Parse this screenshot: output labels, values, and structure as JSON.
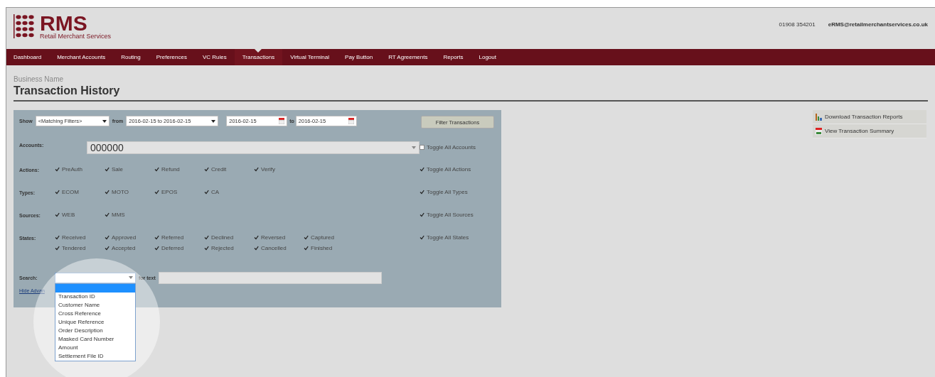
{
  "header": {
    "logo": {
      "name": "RMS",
      "tagline": "Retail Merchant Services"
    },
    "phone": "01908 354201",
    "email": "eRMS@retailmerchantservices.co.uk"
  },
  "nav": [
    {
      "label": "Dashboard",
      "selected": false
    },
    {
      "label": "Merchant Accounts",
      "selected": false
    },
    {
      "label": "Routing",
      "selected": false
    },
    {
      "label": "Preferences",
      "selected": false
    },
    {
      "label": "VC Rules",
      "selected": false
    },
    {
      "label": "Transactions",
      "selected": true
    },
    {
      "label": "Virtual Terminal",
      "selected": false
    },
    {
      "label": "Pay Button",
      "selected": false
    },
    {
      "label": "RT Agreements",
      "selected": false
    },
    {
      "label": "Reports",
      "selected": false
    },
    {
      "label": "Logout",
      "selected": false
    }
  ],
  "page": {
    "business_name": "Business Name",
    "title": "Transaction History"
  },
  "filters": {
    "show_label": "Show",
    "show_value": "<Matching Filters>",
    "from_label": "from",
    "range_value": "2016-02-15 to 2016-02-15",
    "date_from": "2016-02-15",
    "to_label": "to",
    "date_to": "2016-02-15",
    "filter_button": "Filter Transactions",
    "accounts": {
      "label": "Accounts:",
      "value": "000000",
      "toggle": {
        "label": "Toggle All Accounts",
        "checked": false
      }
    },
    "groups": [
      {
        "label": "Actions:",
        "rows": [
          [
            {
              "label": "PreAuth",
              "checked": true
            },
            {
              "label": "Sale",
              "checked": true
            },
            {
              "label": "Refund",
              "checked": true
            },
            {
              "label": "Credit",
              "checked": true
            },
            {
              "label": "Verify",
              "checked": true
            }
          ]
        ],
        "toggle": {
          "label": "Toggle All Actions",
          "checked": true
        }
      },
      {
        "label": "Types:",
        "rows": [
          [
            {
              "label": "ECOM",
              "checked": true
            },
            {
              "label": "MOTO",
              "checked": true
            },
            {
              "label": "EPOS",
              "checked": true
            },
            {
              "label": "CA",
              "checked": true
            }
          ]
        ],
        "toggle": {
          "label": "Toggle All Types",
          "checked": true
        }
      },
      {
        "label": "Sources:",
        "rows": [
          [
            {
              "label": "WEB",
              "checked": true
            },
            {
              "label": "MMS",
              "checked": true
            }
          ]
        ],
        "toggle": {
          "label": "Toggle All Sources",
          "checked": true
        }
      },
      {
        "label": "States:",
        "rows": [
          [
            {
              "label": "Received",
              "checked": true
            },
            {
              "label": "Approved",
              "checked": true
            },
            {
              "label": "Referred",
              "checked": true
            },
            {
              "label": "Declined",
              "checked": true
            },
            {
              "label": "Reversed",
              "checked": true
            },
            {
              "label": "Captured",
              "checked": true
            }
          ],
          [
            {
              "label": "Tendered",
              "checked": true
            },
            {
              "label": "Accepted",
              "checked": true
            },
            {
              "label": "Deferred",
              "checked": true
            },
            {
              "label": "Rejected",
              "checked": true
            },
            {
              "label": "Cancelled",
              "checked": true
            },
            {
              "label": "Finished",
              "checked": true
            }
          ]
        ],
        "toggle": {
          "label": "Toggle All States",
          "checked": true
        }
      }
    ],
    "search": {
      "label": "Search:",
      "for_label": "for text",
      "blank_option": {
        "selected": true
      },
      "options": [
        {
          "label": "Transaction ID",
          "selected": false
        },
        {
          "label": "Customer Name",
          "selected": false
        },
        {
          "label": "Cross Reference",
          "selected": false
        },
        {
          "label": "Unique Reference",
          "selected": false
        },
        {
          "label": "Order Description",
          "selected": false
        },
        {
          "label": "Masked Card Number",
          "selected": false
        },
        {
          "label": "Amount",
          "selected": false
        },
        {
          "label": "Settlement File ID",
          "selected": false
        }
      ]
    },
    "hide_link": "Hide Advan"
  },
  "side_links": [
    {
      "kind": "download",
      "label": "Download Transaction Reports"
    },
    {
      "kind": "summary",
      "label": "View Transaction Summary"
    }
  ]
}
